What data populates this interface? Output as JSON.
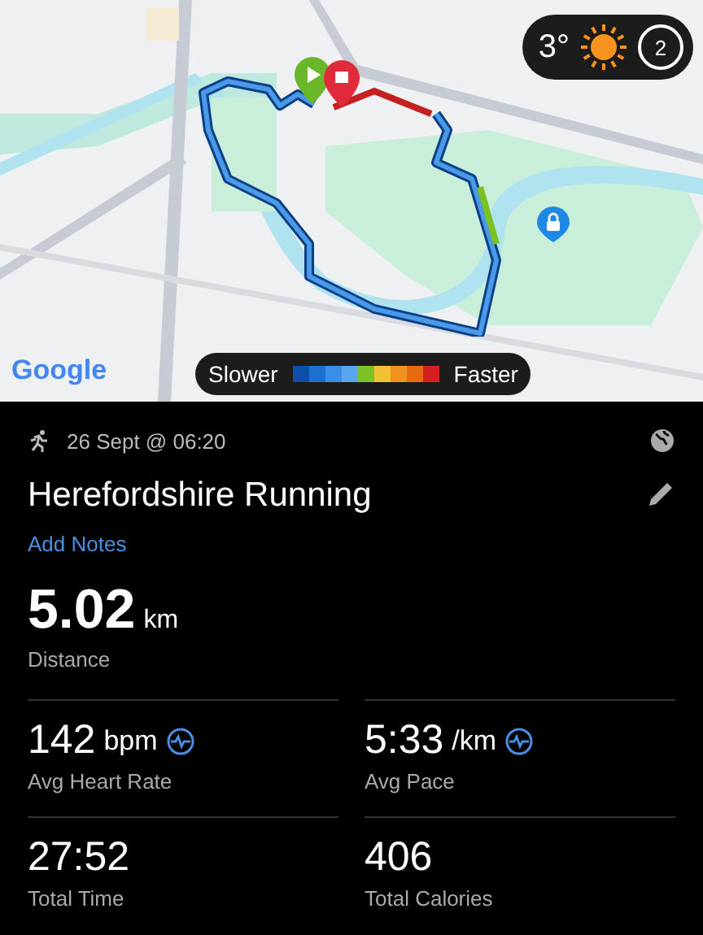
{
  "map": {
    "kind": "picture",
    "attribution": "Google",
    "weather": {
      "temperature": "3°",
      "badge": "2"
    },
    "legend": {
      "slow_label": "Slower",
      "fast_label": "Faster",
      "segments": [
        {
          "color": "#0d4fa8"
        },
        {
          "color": "#1d6fd0"
        },
        {
          "color": "#3b8ee6"
        },
        {
          "color": "#5aa6ee"
        },
        {
          "color": "#7cc224"
        },
        {
          "color": "#f2c230"
        },
        {
          "color": "#f0901e"
        },
        {
          "color": "#e86a12"
        },
        {
          "color": "#d42020"
        }
      ]
    }
  },
  "activity": {
    "date": "26 Sept @ 06:20",
    "title": "Herefordshire Running",
    "add_notes": "Add Notes"
  },
  "distance": {
    "value": "5.02",
    "unit": "km",
    "label": "Distance"
  },
  "stats": [
    {
      "value": "142",
      "unit": "bpm",
      "label": "Avg Heart Rate",
      "kind": "graph"
    },
    {
      "value": "5:33",
      "unit": "/km",
      "label": "Avg Pace",
      "kind": "graph"
    },
    {
      "value": "27:52",
      "label": "Total Time",
      "kind": "plain"
    },
    {
      "value": "406",
      "label": "Total Calories",
      "kind": "plain"
    }
  ]
}
